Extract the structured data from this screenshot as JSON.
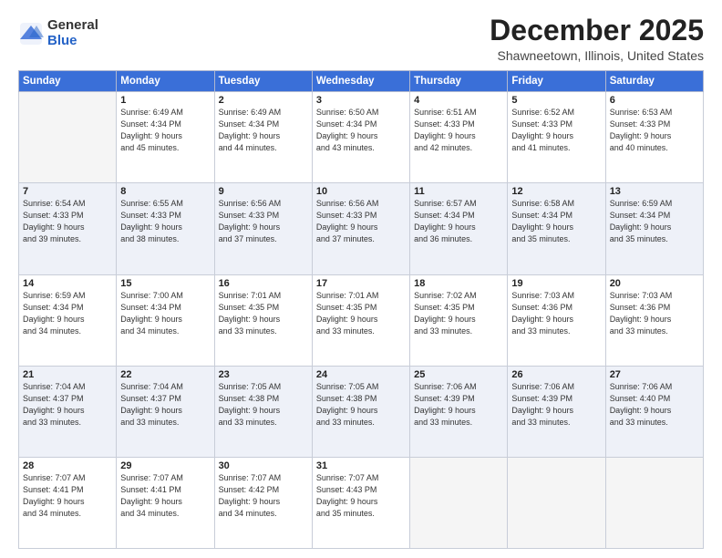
{
  "header": {
    "logo_general": "General",
    "logo_blue": "Blue",
    "month_title": "December 2025",
    "location": "Shawneetown, Illinois, United States"
  },
  "days_of_week": [
    "Sunday",
    "Monday",
    "Tuesday",
    "Wednesday",
    "Thursday",
    "Friday",
    "Saturday"
  ],
  "weeks": [
    [
      {
        "day": "",
        "info": ""
      },
      {
        "day": "1",
        "info": "Sunrise: 6:49 AM\nSunset: 4:34 PM\nDaylight: 9 hours\nand 45 minutes."
      },
      {
        "day": "2",
        "info": "Sunrise: 6:49 AM\nSunset: 4:34 PM\nDaylight: 9 hours\nand 44 minutes."
      },
      {
        "day": "3",
        "info": "Sunrise: 6:50 AM\nSunset: 4:34 PM\nDaylight: 9 hours\nand 43 minutes."
      },
      {
        "day": "4",
        "info": "Sunrise: 6:51 AM\nSunset: 4:33 PM\nDaylight: 9 hours\nand 42 minutes."
      },
      {
        "day": "5",
        "info": "Sunrise: 6:52 AM\nSunset: 4:33 PM\nDaylight: 9 hours\nand 41 minutes."
      },
      {
        "day": "6",
        "info": "Sunrise: 6:53 AM\nSunset: 4:33 PM\nDaylight: 9 hours\nand 40 minutes."
      }
    ],
    [
      {
        "day": "7",
        "info": "Sunrise: 6:54 AM\nSunset: 4:33 PM\nDaylight: 9 hours\nand 39 minutes."
      },
      {
        "day": "8",
        "info": "Sunrise: 6:55 AM\nSunset: 4:33 PM\nDaylight: 9 hours\nand 38 minutes."
      },
      {
        "day": "9",
        "info": "Sunrise: 6:56 AM\nSunset: 4:33 PM\nDaylight: 9 hours\nand 37 minutes."
      },
      {
        "day": "10",
        "info": "Sunrise: 6:56 AM\nSunset: 4:33 PM\nDaylight: 9 hours\nand 37 minutes."
      },
      {
        "day": "11",
        "info": "Sunrise: 6:57 AM\nSunset: 4:34 PM\nDaylight: 9 hours\nand 36 minutes."
      },
      {
        "day": "12",
        "info": "Sunrise: 6:58 AM\nSunset: 4:34 PM\nDaylight: 9 hours\nand 35 minutes."
      },
      {
        "day": "13",
        "info": "Sunrise: 6:59 AM\nSunset: 4:34 PM\nDaylight: 9 hours\nand 35 minutes."
      }
    ],
    [
      {
        "day": "14",
        "info": "Sunrise: 6:59 AM\nSunset: 4:34 PM\nDaylight: 9 hours\nand 34 minutes."
      },
      {
        "day": "15",
        "info": "Sunrise: 7:00 AM\nSunset: 4:34 PM\nDaylight: 9 hours\nand 34 minutes."
      },
      {
        "day": "16",
        "info": "Sunrise: 7:01 AM\nSunset: 4:35 PM\nDaylight: 9 hours\nand 33 minutes."
      },
      {
        "day": "17",
        "info": "Sunrise: 7:01 AM\nSunset: 4:35 PM\nDaylight: 9 hours\nand 33 minutes."
      },
      {
        "day": "18",
        "info": "Sunrise: 7:02 AM\nSunset: 4:35 PM\nDaylight: 9 hours\nand 33 minutes."
      },
      {
        "day": "19",
        "info": "Sunrise: 7:03 AM\nSunset: 4:36 PM\nDaylight: 9 hours\nand 33 minutes."
      },
      {
        "day": "20",
        "info": "Sunrise: 7:03 AM\nSunset: 4:36 PM\nDaylight: 9 hours\nand 33 minutes."
      }
    ],
    [
      {
        "day": "21",
        "info": "Sunrise: 7:04 AM\nSunset: 4:37 PM\nDaylight: 9 hours\nand 33 minutes."
      },
      {
        "day": "22",
        "info": "Sunrise: 7:04 AM\nSunset: 4:37 PM\nDaylight: 9 hours\nand 33 minutes."
      },
      {
        "day": "23",
        "info": "Sunrise: 7:05 AM\nSunset: 4:38 PM\nDaylight: 9 hours\nand 33 minutes."
      },
      {
        "day": "24",
        "info": "Sunrise: 7:05 AM\nSunset: 4:38 PM\nDaylight: 9 hours\nand 33 minutes."
      },
      {
        "day": "25",
        "info": "Sunrise: 7:06 AM\nSunset: 4:39 PM\nDaylight: 9 hours\nand 33 minutes."
      },
      {
        "day": "26",
        "info": "Sunrise: 7:06 AM\nSunset: 4:39 PM\nDaylight: 9 hours\nand 33 minutes."
      },
      {
        "day": "27",
        "info": "Sunrise: 7:06 AM\nSunset: 4:40 PM\nDaylight: 9 hours\nand 33 minutes."
      }
    ],
    [
      {
        "day": "28",
        "info": "Sunrise: 7:07 AM\nSunset: 4:41 PM\nDaylight: 9 hours\nand 34 minutes."
      },
      {
        "day": "29",
        "info": "Sunrise: 7:07 AM\nSunset: 4:41 PM\nDaylight: 9 hours\nand 34 minutes."
      },
      {
        "day": "30",
        "info": "Sunrise: 7:07 AM\nSunset: 4:42 PM\nDaylight: 9 hours\nand 34 minutes."
      },
      {
        "day": "31",
        "info": "Sunrise: 7:07 AM\nSunset: 4:43 PM\nDaylight: 9 hours\nand 35 minutes."
      },
      {
        "day": "",
        "info": ""
      },
      {
        "day": "",
        "info": ""
      },
      {
        "day": "",
        "info": ""
      }
    ]
  ]
}
